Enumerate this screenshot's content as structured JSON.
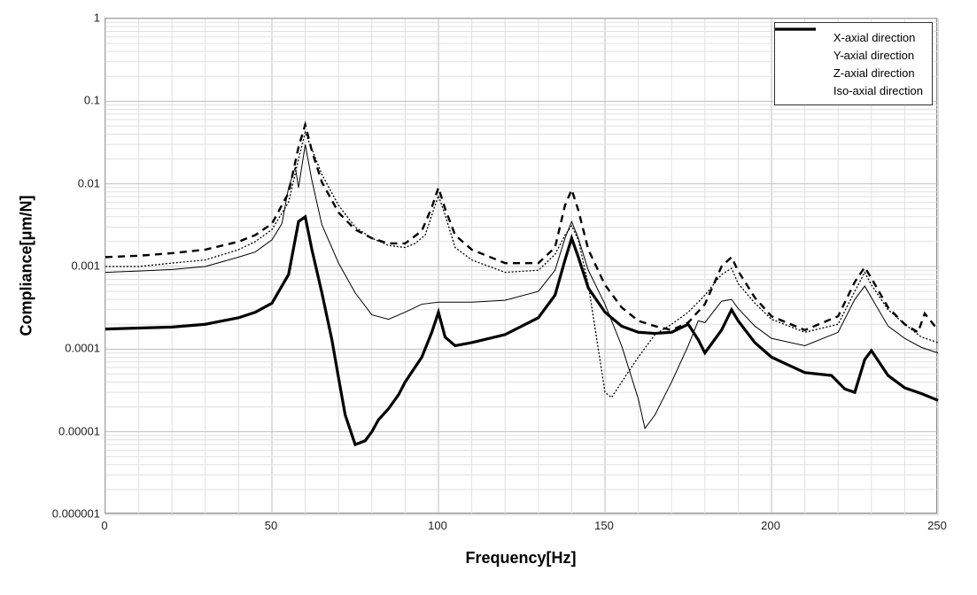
{
  "chart_data": {
    "type": "line",
    "xlabel": "Frequency[Hz]",
    "ylabel": "Compliance[μm/N]",
    "xlim": [
      0,
      250
    ],
    "ylim": [
      1e-06,
      1
    ],
    "x_ticks": [
      0,
      50,
      100,
      150,
      200,
      250
    ],
    "y_ticks": [
      1e-06,
      1e-05,
      0.0001,
      0.001,
      0.01,
      0.1,
      1
    ],
    "y_tick_labels": [
      "0.000001",
      "0.00001",
      "0.0001",
      "0.001",
      "0.01",
      "0.1",
      "1"
    ],
    "legend_position": "top-right",
    "series": [
      {
        "name": "X-axial direction",
        "style": "dotted-thin",
        "x": [
          0,
          10,
          20,
          30,
          40,
          45,
          50,
          55,
          58,
          60,
          65,
          70,
          75,
          80,
          85,
          90,
          93,
          96,
          99,
          100,
          102,
          105,
          110,
          120,
          130,
          135,
          138,
          140,
          142,
          145,
          148,
          150,
          152,
          155,
          160,
          165,
          170,
          175,
          180,
          185,
          188,
          190,
          195,
          200,
          210,
          220,
          225,
          228,
          230,
          235,
          240,
          245,
          250
        ],
        "y": [
          0.001,
          0.001,
          0.0011,
          0.0012,
          0.0016,
          0.002,
          0.0028,
          0.006,
          0.02,
          0.042,
          0.013,
          0.0055,
          0.003,
          0.0022,
          0.0018,
          0.0017,
          0.0019,
          0.0024,
          0.0055,
          0.0072,
          0.0042,
          0.0017,
          0.0012,
          0.00085,
          0.0009,
          0.0014,
          0.0024,
          0.0031,
          0.0021,
          0.0006,
          0.0001,
          3e-05,
          2.6e-05,
          4e-05,
          8e-05,
          0.00015,
          0.0002,
          0.00028,
          0.00045,
          0.0008,
          0.00095,
          0.00062,
          0.00036,
          0.00023,
          0.00016,
          0.0002,
          0.0005,
          0.00085,
          0.0006,
          0.0003,
          0.0002,
          0.00014,
          0.00012
        ]
      },
      {
        "name": "Y-axial direction",
        "style": "solid-bold",
        "x": [
          0,
          10,
          20,
          30,
          40,
          45,
          50,
          55,
          58,
          60,
          62,
          65,
          68,
          70,
          72,
          75,
          78,
          80,
          82,
          85,
          88,
          90,
          95,
          98,
          100,
          102,
          105,
          110,
          120,
          130,
          135,
          138,
          140,
          142,
          145,
          150,
          155,
          160,
          165,
          170,
          175,
          178,
          180,
          185,
          188,
          190,
          195,
          200,
          210,
          218,
          222,
          225,
          228,
          230,
          235,
          240,
          245,
          250
        ],
        "y": [
          0.000175,
          0.00018,
          0.000185,
          0.0002,
          0.00024,
          0.00028,
          0.00036,
          0.0008,
          0.0035,
          0.004,
          0.0016,
          0.00048,
          0.00013,
          4.5e-05,
          1.6e-05,
          7e-06,
          7.8e-06,
          1e-05,
          1.4e-05,
          1.9e-05,
          2.8e-05,
          4e-05,
          8e-05,
          0.00016,
          0.00028,
          0.00014,
          0.00011,
          0.00012,
          0.00015,
          0.00024,
          0.00045,
          0.0012,
          0.0022,
          0.0013,
          0.00055,
          0.00028,
          0.00019,
          0.00016,
          0.000155,
          0.00016,
          0.0002,
          0.00013,
          9e-05,
          0.00017,
          0.0003,
          0.00022,
          0.00012,
          8e-05,
          5.2e-05,
          4.8e-05,
          3.3e-05,
          3e-05,
          7.5e-05,
          9.6e-05,
          4.8e-05,
          3.4e-05,
          2.9e-05,
          2.4e-05
        ]
      },
      {
        "name": "Z-axial direction",
        "style": "solid-thin",
        "x": [
          0,
          10,
          20,
          30,
          40,
          45,
          50,
          53,
          55,
          57,
          58,
          60,
          62,
          65,
          70,
          75,
          80,
          85,
          90,
          95,
          100,
          105,
          110,
          120,
          130,
          135,
          138,
          140,
          142,
          145,
          150,
          155,
          160,
          162,
          165,
          170,
          175,
          178,
          180,
          185,
          188,
          190,
          195,
          200,
          210,
          220,
          225,
          228,
          230,
          235,
          240,
          245,
          250
        ],
        "y": [
          0.00085,
          0.00088,
          0.00092,
          0.001,
          0.0013,
          0.0015,
          0.0021,
          0.0033,
          0.009,
          0.016,
          0.009,
          0.03,
          0.011,
          0.0032,
          0.0011,
          0.00048,
          0.00026,
          0.00023,
          0.00028,
          0.00035,
          0.00037,
          0.00037,
          0.00037,
          0.00039,
          0.0005,
          0.0009,
          0.0022,
          0.0035,
          0.0022,
          0.0009,
          0.00035,
          0.00011,
          2.5e-05,
          1.1e-05,
          1.6e-05,
          4e-05,
          0.00011,
          0.00022,
          0.00021,
          0.00038,
          0.0004,
          0.00031,
          0.00019,
          0.000135,
          0.00011,
          0.00016,
          0.0004,
          0.00058,
          0.00042,
          0.00019,
          0.000135,
          0.000105,
          9e-05
        ]
      },
      {
        "name": "Iso-axial direction",
        "style": "dashed-bold",
        "x": [
          0,
          10,
          20,
          30,
          40,
          45,
          50,
          55,
          58,
          60,
          62,
          65,
          70,
          75,
          80,
          85,
          90,
          95,
          98,
          100,
          102,
          105,
          110,
          120,
          130,
          135,
          138,
          140,
          142,
          145,
          150,
          155,
          160,
          165,
          170,
          175,
          180,
          185,
          188,
          190,
          195,
          200,
          210,
          220,
          225,
          228,
          230,
          235,
          240,
          244,
          246,
          250
        ],
        "y": [
          0.0013,
          0.00135,
          0.00145,
          0.0016,
          0.002,
          0.0024,
          0.0033,
          0.0078,
          0.028,
          0.052,
          0.025,
          0.0105,
          0.0045,
          0.0028,
          0.0022,
          0.0019,
          0.0019,
          0.0027,
          0.0052,
          0.009,
          0.005,
          0.0024,
          0.0016,
          0.0011,
          0.0011,
          0.0017,
          0.0055,
          0.0085,
          0.0048,
          0.0016,
          0.0006,
          0.00032,
          0.00022,
          0.00019,
          0.00017,
          0.00021,
          0.00035,
          0.001,
          0.0013,
          0.00088,
          0.00042,
          0.00025,
          0.00017,
          0.00025,
          0.00065,
          0.00098,
          0.00072,
          0.00032,
          0.0002,
          0.00016,
          0.00027,
          0.00017
        ]
      }
    ]
  }
}
